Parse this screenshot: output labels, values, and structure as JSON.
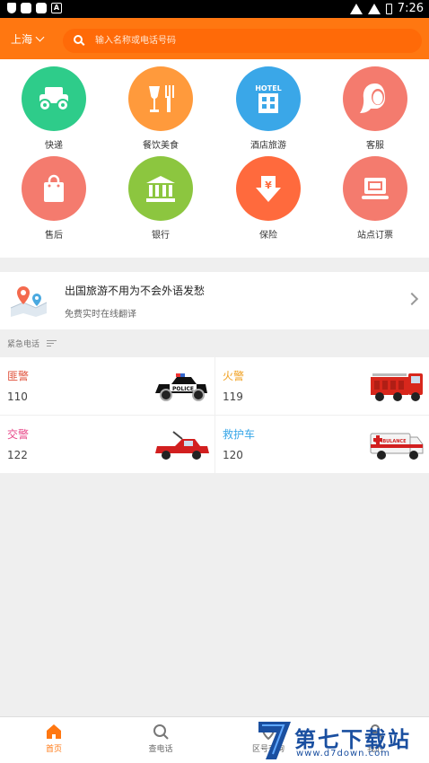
{
  "status_bar": {
    "time": "7:26"
  },
  "header": {
    "city": "上海",
    "search_placeholder": "输入名称或电话号码"
  },
  "categories": [
    {
      "label": "快递",
      "color": "#2ecc8a",
      "icon": "truck-icon"
    },
    {
      "label": "餐饮美食",
      "color": "#ff9a3c",
      "icon": "food-icon"
    },
    {
      "label": "酒店旅游",
      "color": "#3aa7e8",
      "icon": "hotel-icon"
    },
    {
      "label": "客服",
      "color": "#f47b6e",
      "icon": "customer-service-icon"
    },
    {
      "label": "售后",
      "color": "#f47b6e",
      "icon": "shopping-bag-icon"
    },
    {
      "label": "银行",
      "color": "#8cc63f",
      "icon": "bank-icon"
    },
    {
      "label": "保险",
      "color": "#ff6a3d",
      "icon": "insurance-icon"
    },
    {
      "label": "站点订票",
      "color": "#f47b6e",
      "icon": "ticket-icon"
    }
  ],
  "promo": {
    "title": "出国旅游不用为不会外语发愁",
    "subtitle": "免费实时在线翻译"
  },
  "emergency": {
    "section_label": "紧急电话",
    "items": [
      {
        "title": "匪警",
        "number": "110",
        "color": "#e0533d",
        "icon": "police-car-icon"
      },
      {
        "title": "火警",
        "number": "119",
        "color": "#f0a020",
        "icon": "fire-truck-icon"
      },
      {
        "title": "交警",
        "number": "122",
        "color": "#e84a8a",
        "icon": "traffic-police-car-icon"
      },
      {
        "title": "救护车",
        "number": "120",
        "color": "#3aa7e8",
        "icon": "ambulance-icon"
      }
    ]
  },
  "tabs": [
    {
      "label": "首页",
      "active": true
    },
    {
      "label": "查电话",
      "active": false
    },
    {
      "label": "区号查询",
      "active": false
    },
    {
      "label": "我的",
      "active": false
    }
  ],
  "watermark": {
    "text": "第七下载站",
    "url": "www.d7down.com"
  },
  "colors": {
    "accent": "#ff7711",
    "active_tab": "#ff7711"
  }
}
